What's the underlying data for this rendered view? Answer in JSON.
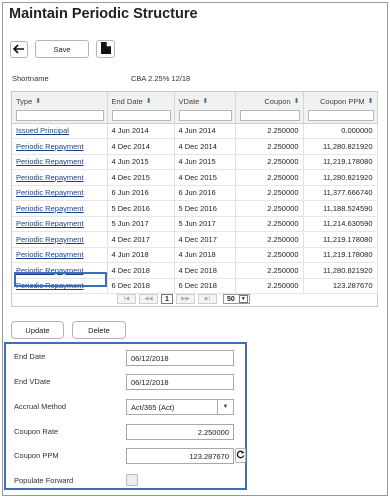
{
  "page": {
    "title": "Maintain Periodic Structure"
  },
  "toolbar": {
    "back_icon": "arrow-left-icon",
    "save_label": "Save",
    "document_icon": "document-icon"
  },
  "shortname": {
    "label": "Shortname",
    "value": "CBA 2.25% 12/18"
  },
  "grid": {
    "columns": [
      "Type",
      "End Date",
      "VDate",
      "Coupon",
      "Coupon PPM"
    ],
    "rows": [
      {
        "type": "Issued Principal",
        "end_date": "4 Jun 2014",
        "vdate": "4 Jun 2014",
        "coupon": "2.250000",
        "coupon_ppm": "0.000000"
      },
      {
        "type": "Periodic Repayment",
        "end_date": "4 Dec 2014",
        "vdate": "4 Dec 2014",
        "coupon": "2.250000",
        "coupon_ppm": "11,280.821920"
      },
      {
        "type": "Periodic Repayment",
        "end_date": "4 Jun 2015",
        "vdate": "4 Jun 2015",
        "coupon": "2.250000",
        "coupon_ppm": "11,219.178080"
      },
      {
        "type": "Periodic Repayment",
        "end_date": "4 Dec 2015",
        "vdate": "4 Dec 2015",
        "coupon": "2.250000",
        "coupon_ppm": "11,280.821920"
      },
      {
        "type": "Periodic Repayment",
        "end_date": "6 Jun 2016",
        "vdate": "6 Jun 2016",
        "coupon": "2.250000",
        "coupon_ppm": "11,377.666740"
      },
      {
        "type": "Periodic Repayment",
        "end_date": "5 Dec 2016",
        "vdate": "5 Dec 2016",
        "coupon": "2.250000",
        "coupon_ppm": "11,188.524590"
      },
      {
        "type": "Periodic Repayment",
        "end_date": "5 Jun 2017",
        "vdate": "5 Jun 2017",
        "coupon": "2.250000",
        "coupon_ppm": "11,214.630590"
      },
      {
        "type": "Periodic Repayment",
        "end_date": "4 Dec 2017",
        "vdate": "4 Dec 2017",
        "coupon": "2.250000",
        "coupon_ppm": "11,219.178080"
      },
      {
        "type": "Periodic Repayment",
        "end_date": "4 Jun 2018",
        "vdate": "4 Jun 2018",
        "coupon": "2.250000",
        "coupon_ppm": "11,219.178080"
      },
      {
        "type": "Periodic Repayment",
        "end_date": "4 Dec 2018",
        "vdate": "4 Dec 2018",
        "coupon": "2.250000",
        "coupon_ppm": "11,280.821920"
      },
      {
        "type": "Periodic Repayment",
        "end_date": "6 Dec 2018",
        "vdate": "6 Dec 2018",
        "coupon": "2.250000",
        "coupon_ppm": "123.287670"
      }
    ],
    "selected_row": 10,
    "pager": {
      "first": "|◀",
      "prev": "◀◀",
      "page": "1",
      "next": "▶▶",
      "last": "▶|",
      "page_size": "50"
    }
  },
  "actions": {
    "update_label": "Update",
    "delete_label": "Delete"
  },
  "form": {
    "end_date": {
      "label": "End Date",
      "value": "06/12/2018"
    },
    "end_vdate": {
      "label": "End VDate",
      "value": "06/12/2018"
    },
    "accrual_method": {
      "label": "Accrual Method",
      "value": "Act/365 (Act)"
    },
    "coupon_rate": {
      "label": "Coupon Rate",
      "value": "2.250000"
    },
    "coupon_ppm": {
      "label": "Coupon PPM",
      "value": "123.287670",
      "refresh_icon": "refresh-icon"
    },
    "populate_forward": {
      "label": "Populate Forward",
      "checked": false
    }
  },
  "colors": {
    "highlight_border": "#3d6fb8",
    "link": "#1c3f8c"
  }
}
